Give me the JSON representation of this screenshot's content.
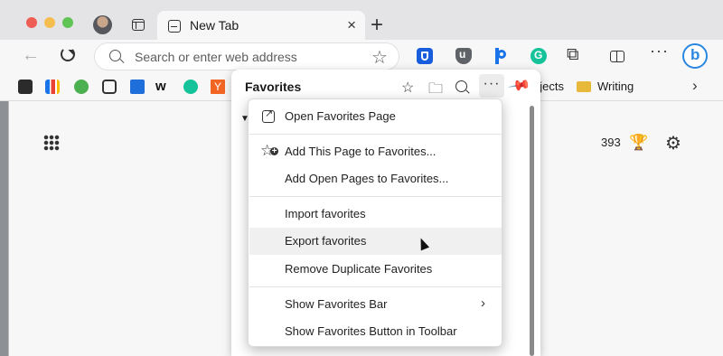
{
  "tab": {
    "title": "New Tab",
    "close_glyph": "×"
  },
  "new_tab_glyph": "+",
  "address_bar": {
    "placeholder": "Search or enter web address"
  },
  "toolbar": {
    "back_glyph": "←",
    "star_glyph": "☆",
    "extensions_glyph": "⧉",
    "more_glyph": "···"
  },
  "favorites_bar": {
    "items": [
      {
        "icon": "monitor-icon"
      },
      {
        "icon": "chart-icon"
      },
      {
        "icon": "play-icon"
      },
      {
        "icon": "mail-icon"
      },
      {
        "icon": "docs-icon"
      },
      {
        "icon": "w-logo-icon",
        "glyph": "w"
      },
      {
        "icon": "grammarly-icon"
      },
      {
        "icon": "y-combinator-icon",
        "glyph": "Y"
      }
    ],
    "projects_label": "ojects",
    "writing_label": "Writing",
    "overflow_glyph": "›"
  },
  "page": {
    "rewards_count": "393",
    "trophy_glyph": "🏆",
    "settings_glyph": "⚙",
    "collapse_glyph": "▼"
  },
  "favorites_flyout": {
    "title": "Favorites",
    "add_glyph": "☆",
    "folder_glyph": "🗀",
    "more_glyph": "···",
    "pin_glyph": "📌"
  },
  "context_menu": {
    "items": [
      {
        "label": "Open Favorites Page"
      },
      {
        "label": "Add This Page to Favorites..."
      },
      {
        "label": "Add Open Pages to Favorites..."
      },
      {
        "label": "Import favorites"
      },
      {
        "label": "Export favorites",
        "hovered": true
      },
      {
        "label": "Remove Duplicate Favorites"
      },
      {
        "label": "Show Favorites Bar",
        "submenu_glyph": "›"
      },
      {
        "label": "Show Favorites Button in Toolbar"
      }
    ]
  },
  "colors": {
    "traffic_red": "#ee5e55",
    "traffic_yellow": "#f5bd4f",
    "traffic_green": "#5fc454",
    "accent_blue": "#2a88e0"
  }
}
